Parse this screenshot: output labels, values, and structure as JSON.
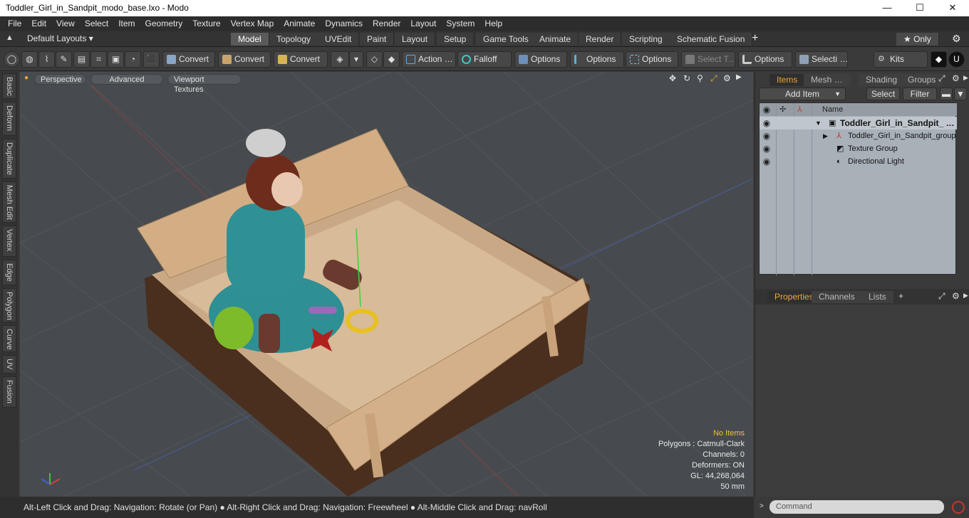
{
  "window": {
    "title": "Toddler_Girl_in_Sandpit_modo_base.lxo - Modo",
    "minimize": "—",
    "maximize": "☐",
    "close": "✕"
  },
  "menubar": [
    "File",
    "Edit",
    "View",
    "Select",
    "Item",
    "Geometry",
    "Texture",
    "Vertex Map",
    "Animate",
    "Dynamics",
    "Render",
    "Layout",
    "System",
    "Help"
  ],
  "layouts": {
    "dropdown": "Default Layouts ▾",
    "tabs": [
      "Model",
      "Topology",
      "UVEdit",
      "Paint",
      "Layout",
      "Setup",
      "Game Tools",
      "Animate",
      "Render",
      "Scripting",
      "Schematic Fusion"
    ],
    "active": "Model",
    "add": "+",
    "only": "★ Only",
    "gear": "⚙"
  },
  "toolbar": {
    "convert1": "Convert",
    "convert2": "Convert",
    "convert3": "Convert",
    "action": "Action …",
    "falloff": "Falloff",
    "options1": "Options",
    "options2": "Options",
    "options3": "Options",
    "select_t": "Select T…",
    "options4": "Options",
    "selecti": "Selecti …",
    "kits": "Kits"
  },
  "left_tabs": [
    "Basic",
    "Deform",
    "Duplicate",
    "Mesh Edit",
    "Vertex",
    "Edge",
    "Polygon",
    "Curve",
    "UV",
    "Fusion"
  ],
  "viewport": {
    "perspective": "Perspective",
    "advanced": "Advanced",
    "textures": "Viewport Textures",
    "info": {
      "no_items": "No Items",
      "polygons": "Polygons : Catmull-Clark",
      "channels": "Channels: 0",
      "deformers": "Deformers: ON",
      "gl": "GL: 44,268,064",
      "scale": "50 mm"
    }
  },
  "statusbar": "Alt-Left Click and Drag: Navigation: Rotate (or Pan) ● Alt-Right Click and Drag: Navigation: Freewheel ● Alt-Middle Click and Drag: navRoll",
  "items_panel": {
    "tabs": [
      "Items",
      "Mesh …",
      "Shading",
      "Groups"
    ],
    "active": "Items",
    "add_item": "Add Item",
    "select": "Select",
    "filter": "Filter",
    "name_col": "Name",
    "rows": [
      {
        "label": "Toddler_Girl_in_Sandpit_ …",
        "icon": "scene-icon"
      },
      {
        "label": "Toddler_Girl_in_Sandpit_group",
        "icon": "group-icon"
      },
      {
        "label": "Texture Group",
        "icon": "texture-icon"
      },
      {
        "label": "Directional Light",
        "icon": "light-icon"
      }
    ]
  },
  "properties_panel": {
    "tabs": [
      "Properties",
      "Channels",
      "Lists"
    ],
    "active": "Properties",
    "add": "+"
  },
  "command": {
    "placeholder": "Command"
  }
}
